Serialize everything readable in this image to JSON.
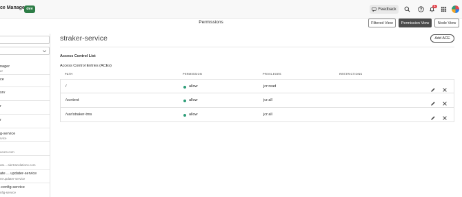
{
  "header": {
    "app_title": "ce Manager",
    "env_badge": "dev",
    "feedback_label": "Feedback",
    "notification_count": "1"
  },
  "subbar": {
    "title": "Permissions",
    "views": [
      "Filtered View",
      "Permission View",
      "Node View"
    ],
    "active_view": "Permission View"
  },
  "sidebar": {
    "items": [
      {
        "title": "nager",
        "subtitle": "er"
      },
      {
        "title": "ce",
        "subtitle": ""
      },
      {
        "title": "srv",
        "subtitle": ""
      },
      {
        "title": "r",
        "subtitle": ""
      },
      {
        "title": "r",
        "subtitle": ""
      },
      {
        "title": "g-service",
        "subtitle": "rvice"
      },
      {
        "title": "",
        "subtitle": "ucom.com"
      },
      {
        "title": "",
        "subtitle": "ato... alertranslations.com"
      },
      {
        "title": "ate ... updater-service",
        "subtitle": "nt-updater-service"
      },
      {
        "title": "-config-service",
        "subtitle": "nfig-service"
      }
    ]
  },
  "main": {
    "service_title": "straker-service",
    "add_ace_label": "Add ACE",
    "acl_title": "Access Control List",
    "ace_title": "Access Control Entries (ACEs)",
    "columns": [
      "PATH",
      "PERMISSION",
      "PRIVILEGES",
      "RESTRICTIONS"
    ],
    "rows": [
      {
        "path": "/",
        "permission": "allow",
        "privileges": "jcr:read",
        "restrictions": ""
      },
      {
        "path": "/content",
        "permission": "allow",
        "privileges": "jcr:all",
        "restrictions": ""
      },
      {
        "path": "/var/straker-tms",
        "permission": "allow",
        "privileges": "jcr:all",
        "restrictions": ""
      }
    ]
  },
  "icons": {
    "feedback": "feedback-icon",
    "search": "search-icon",
    "help": "help-icon",
    "bell": "bell-icon",
    "apps": "apps-grid-icon",
    "edit": "edit-icon",
    "delete": "close-icon"
  },
  "colors": {
    "env_badge": "#2d7d46",
    "allow_dot": "#2d9d78",
    "notification": "#e34850",
    "active_view": "#4b4b4b"
  }
}
